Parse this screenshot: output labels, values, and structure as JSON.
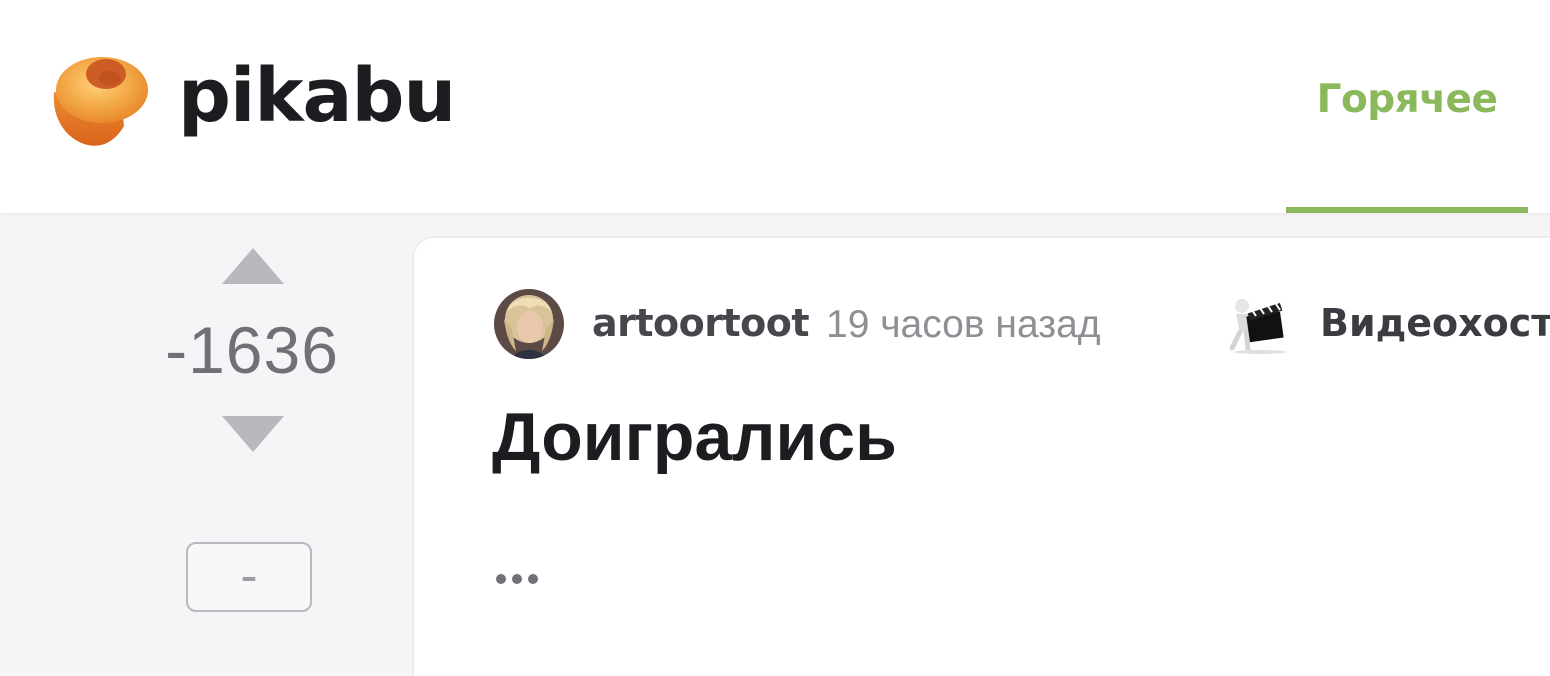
{
  "header": {
    "logo_text": "pikabu",
    "nav_tab_label": "Горячее",
    "accent_color": "#8ab85a"
  },
  "post": {
    "rating": "-1636",
    "hide_button_label": "–",
    "author": "artoortoot",
    "time": "19 часов назад",
    "community": "Видеохостинг",
    "title": "Доигрались",
    "icons": [
      "vote-up-arrow",
      "vote-down-arrow",
      "user-avatar",
      "clapperboard-community-icon",
      "ellipsis-more"
    ]
  }
}
